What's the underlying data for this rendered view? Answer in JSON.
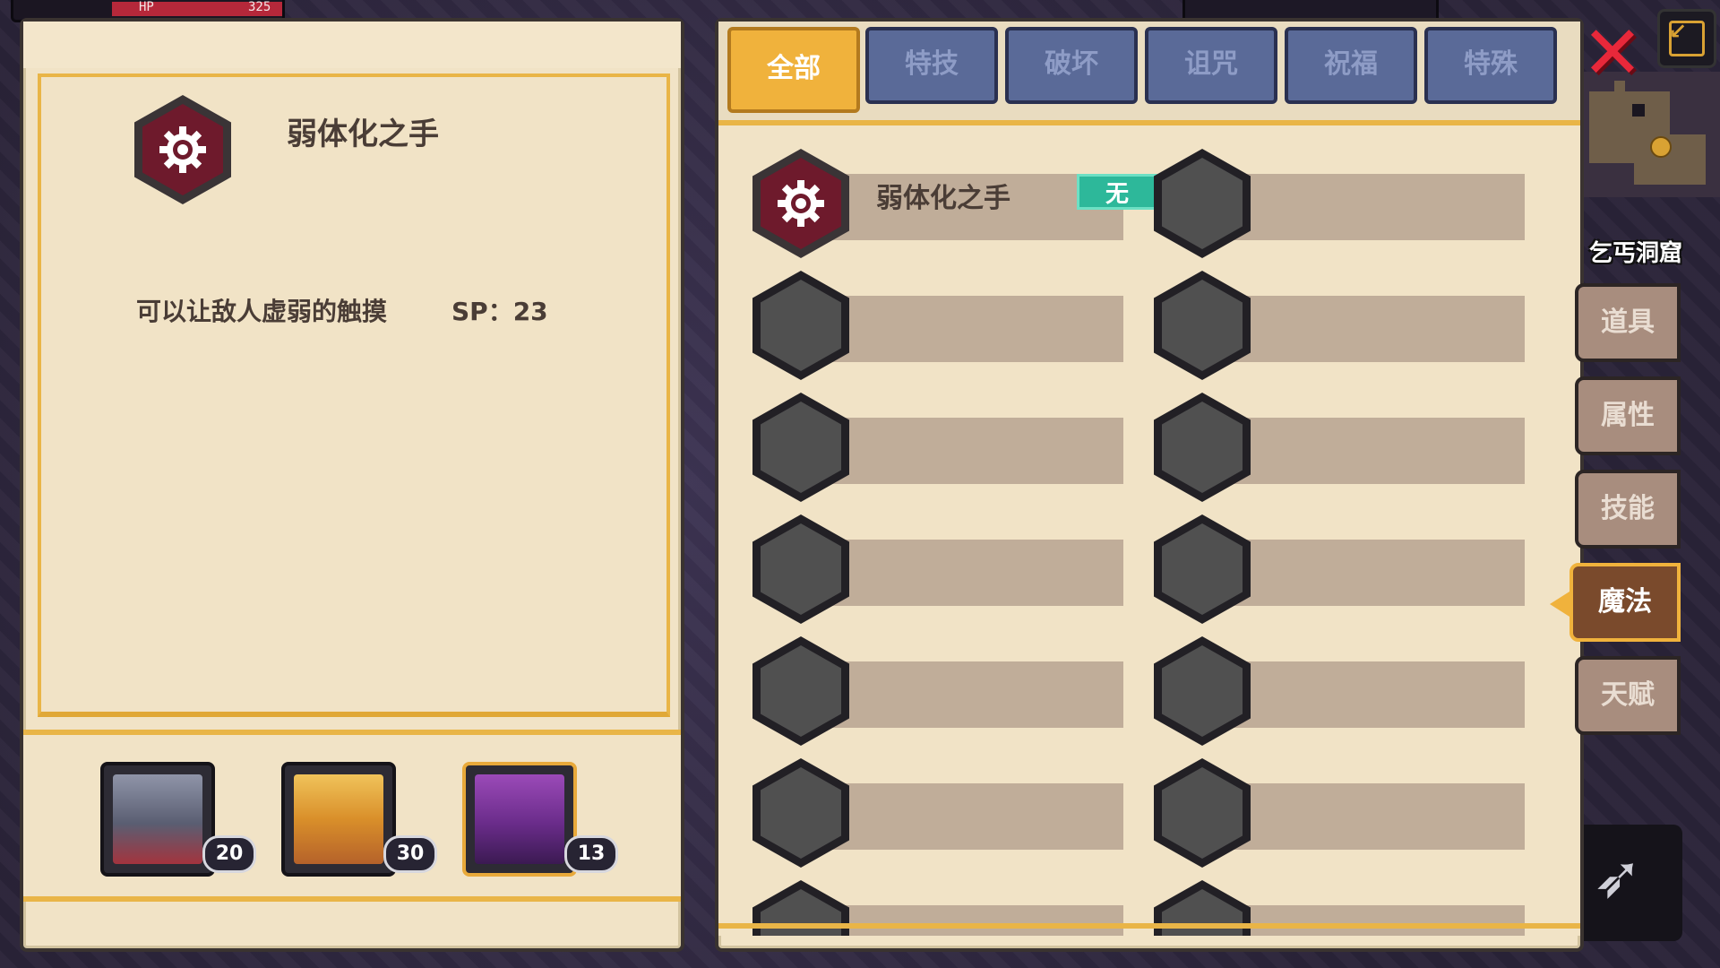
{
  "hud": {
    "hp_label": "HP",
    "hp_value": "325"
  },
  "detail": {
    "title": "弱体化之手",
    "description": "可以让敌人虚弱的触摸",
    "sp": "SP：23",
    "icon": "gear-icon"
  },
  "party": [
    {
      "level": "20",
      "selected": false
    },
    {
      "level": "30",
      "selected": false
    },
    {
      "level": "13",
      "selected": true
    }
  ],
  "filter_tabs": [
    {
      "label": "全部",
      "active": true
    },
    {
      "label": "特技",
      "active": false
    },
    {
      "label": "破坏",
      "active": false
    },
    {
      "label": "诅咒",
      "active": false
    },
    {
      "label": "祝福",
      "active": false
    },
    {
      "label": "特殊",
      "active": false
    }
  ],
  "skills": [
    {
      "name": "弱体化之手",
      "badge": "无"
    }
  ],
  "side_tabs": [
    {
      "label": "道具",
      "active": false
    },
    {
      "label": "属性",
      "active": false
    },
    {
      "label": "技能",
      "active": false
    },
    {
      "label": "魔法",
      "active": true
    },
    {
      "label": "天赋",
      "active": false
    }
  ],
  "location": "乞丐洞窟",
  "colors": {
    "accent": "#f0b23c",
    "panel": "#f1e3c6",
    "badge": "#2db89a",
    "close": "#e8283a"
  }
}
